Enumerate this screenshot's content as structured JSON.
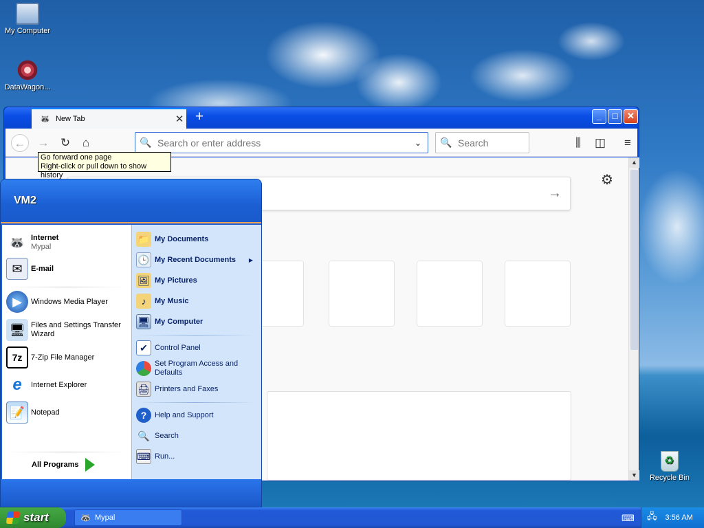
{
  "desktop": {
    "icons": [
      {
        "label": "My Computer"
      },
      {
        "label": "DataWagon..."
      },
      {
        "label": "Recycle Bin"
      }
    ]
  },
  "browser": {
    "tab_title": "New Tab",
    "tab_close": "✕",
    "new_tab": "+",
    "url_placeholder": "Search or enter address",
    "search_placeholder": "Search",
    "tooltip_line1": "Go forward one page",
    "tooltip_line2": "Right-click or pull down to show history"
  },
  "start_menu": {
    "user": "VM2",
    "pinned": [
      {
        "label": "Internet",
        "sub": "Mypal"
      },
      {
        "label": "E-mail"
      }
    ],
    "recent": [
      {
        "label": "Windows Media Player"
      },
      {
        "label": "Files and Settings Transfer Wizard"
      },
      {
        "label": "7-Zip File Manager"
      },
      {
        "label": "Internet Explorer"
      },
      {
        "label": "Notepad"
      }
    ],
    "all_programs": "All Programs",
    "places": [
      {
        "label": "My Documents"
      },
      {
        "label": "My Recent Documents"
      },
      {
        "label": "My Pictures"
      },
      {
        "label": "My Music"
      },
      {
        "label": "My Computer"
      }
    ],
    "settings": [
      {
        "label": "Control Panel"
      },
      {
        "label": "Set Program Access and Defaults"
      },
      {
        "label": "Printers and Faxes"
      }
    ],
    "help": [
      {
        "label": "Help and Support"
      },
      {
        "label": "Search"
      },
      {
        "label": "Run..."
      }
    ]
  },
  "taskbar": {
    "start": "start",
    "task_item": "Mypal",
    "clock": "3:56 AM"
  },
  "colors": {
    "xp_blue": "#0a4ee6",
    "start_green": "#3a9a3a",
    "start_menu_right": "#d3e5fa"
  }
}
